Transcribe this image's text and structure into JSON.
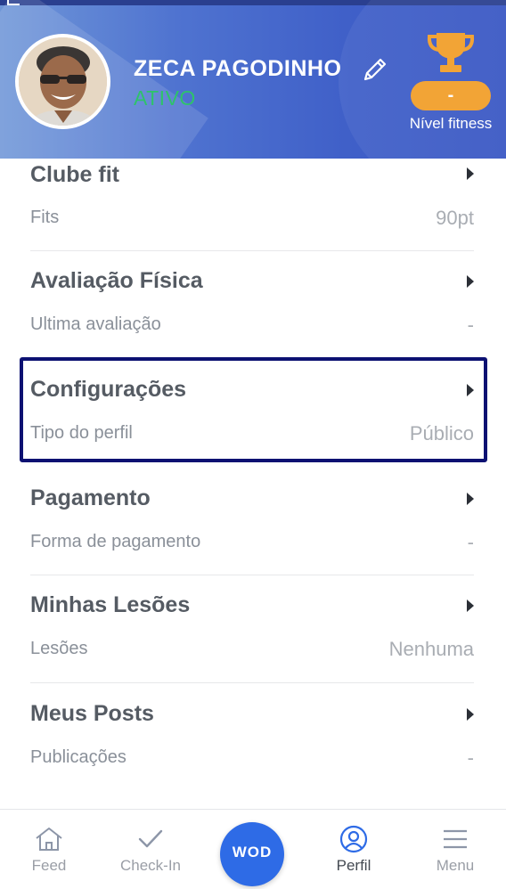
{
  "profile": {
    "name": "ZECA PAGODINHO",
    "status": "ATIVO",
    "fitness_level_value": "-",
    "fitness_level_label": "Nível fitness"
  },
  "sections": [
    {
      "title": "Clube fit",
      "subtitle": "Fits",
      "value": "90pt"
    },
    {
      "title": "Avaliação Física",
      "subtitle": "Ultima avaliação",
      "value": "-"
    },
    {
      "title": "Configurações",
      "subtitle": "Tipo do perfil",
      "value": "Público"
    },
    {
      "title": "Pagamento",
      "subtitle": "Forma de pagamento",
      "value": "-"
    },
    {
      "title": "Minhas Lesões",
      "subtitle": "Lesões",
      "value": "Nenhuma"
    },
    {
      "title": "Meus Posts",
      "subtitle": "Publicações",
      "value": "-"
    }
  ],
  "nav": {
    "feed": "Feed",
    "checkin": "Check-In",
    "wod": "WOD",
    "perfil": "Perfil",
    "menu": "Menu"
  },
  "colors": {
    "header_blue": "#3f5fc8",
    "status_green": "#2ec36a",
    "badge_orange": "#f2a436",
    "highlight_navy": "#0c1172",
    "wod_blue": "#2e6be6"
  }
}
